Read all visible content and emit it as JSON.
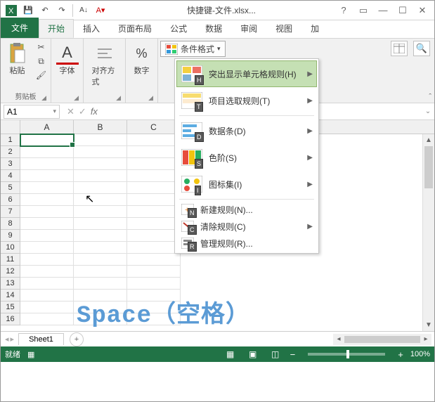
{
  "title": "快捷键-文件.xlsx...",
  "qat": {
    "save": "💾",
    "undo": "↶",
    "redo": "↷"
  },
  "win": {
    "help": "?",
    "ribbon_opts": "▭",
    "min": "—",
    "max": "☐",
    "close": "✕"
  },
  "tabs": {
    "file": "文件",
    "home": "开始",
    "insert": "插入",
    "layout": "页面布局",
    "formulas": "公式",
    "data": "数据",
    "review": "审阅",
    "view": "视图",
    "add": "加"
  },
  "ribbon": {
    "clipboard": {
      "paste": "粘贴",
      "label": "剪贴板"
    },
    "font": {
      "btn": "字体"
    },
    "align": {
      "btn": "对齐方式"
    },
    "number": {
      "btn": "数字"
    },
    "cf_button": "条件格式"
  },
  "cf_menu": {
    "highlight": "突出显示单元格规则(H)",
    "top_bottom": "项目选取规则(T)",
    "data_bars": "数据条(D)",
    "color_scales": "色阶(S)",
    "icon_sets": "图标集(I)",
    "new_rule": "新建规则(N)...",
    "clear_rules": "清除规则(C)",
    "manage_rules": "管理规则(R)...",
    "keys": {
      "h": "H",
      "t": "T",
      "d": "D",
      "s": "S",
      "i": "I",
      "n": "N",
      "c": "C",
      "r": "R"
    }
  },
  "formula": {
    "name_box": "A1",
    "cancel": "✕",
    "enter": "✓",
    "fx": "fx"
  },
  "grid": {
    "cols": [
      "A",
      "B",
      "C"
    ],
    "rows": [
      "1",
      "2",
      "3",
      "4",
      "5",
      "6",
      "7",
      "8",
      "9",
      "10",
      "11",
      "12",
      "13",
      "14",
      "15",
      "16"
    ]
  },
  "sheet": {
    "tab1": "Sheet1",
    "add": "+"
  },
  "status": {
    "ready": "就绪",
    "zoom": "100%"
  },
  "watermark": "Space（空格）"
}
